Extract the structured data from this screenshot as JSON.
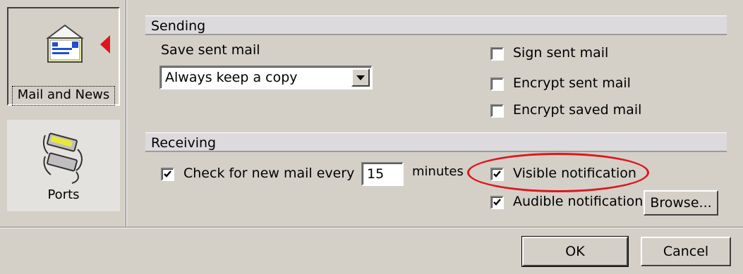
{
  "nav": {
    "mail_label": "Mail and News",
    "ports_label": "Ports"
  },
  "sending": {
    "header": "Sending",
    "save_sent_label": "Save sent mail",
    "save_sent_value": "Always keep a copy",
    "sign_label": "Sign sent mail",
    "sign_checked": false,
    "encrypt_sent_label": "Encrypt sent mail",
    "encrypt_sent_checked": false,
    "encrypt_saved_label": "Encrypt saved mail",
    "encrypt_saved_checked": false
  },
  "receiving": {
    "header": "Receiving",
    "check_label": "Check for new mail every",
    "check_checked": true,
    "interval_value": "15",
    "minutes_label": "minutes",
    "visible_label": "Visible notification",
    "visible_checked": true,
    "audible_label": "Audible notification",
    "audible_checked": true,
    "browse_label": "Browse..."
  },
  "footer": {
    "ok_label": "OK",
    "cancel_label": "Cancel"
  },
  "colors": {
    "dialog_bg": "#d4d0c8",
    "highlight_oval": "#e0141e",
    "nav_arrow": "#e0141e"
  },
  "icons": {
    "mail": "mail-envelope-icon",
    "ports": "network-ports-icon"
  }
}
